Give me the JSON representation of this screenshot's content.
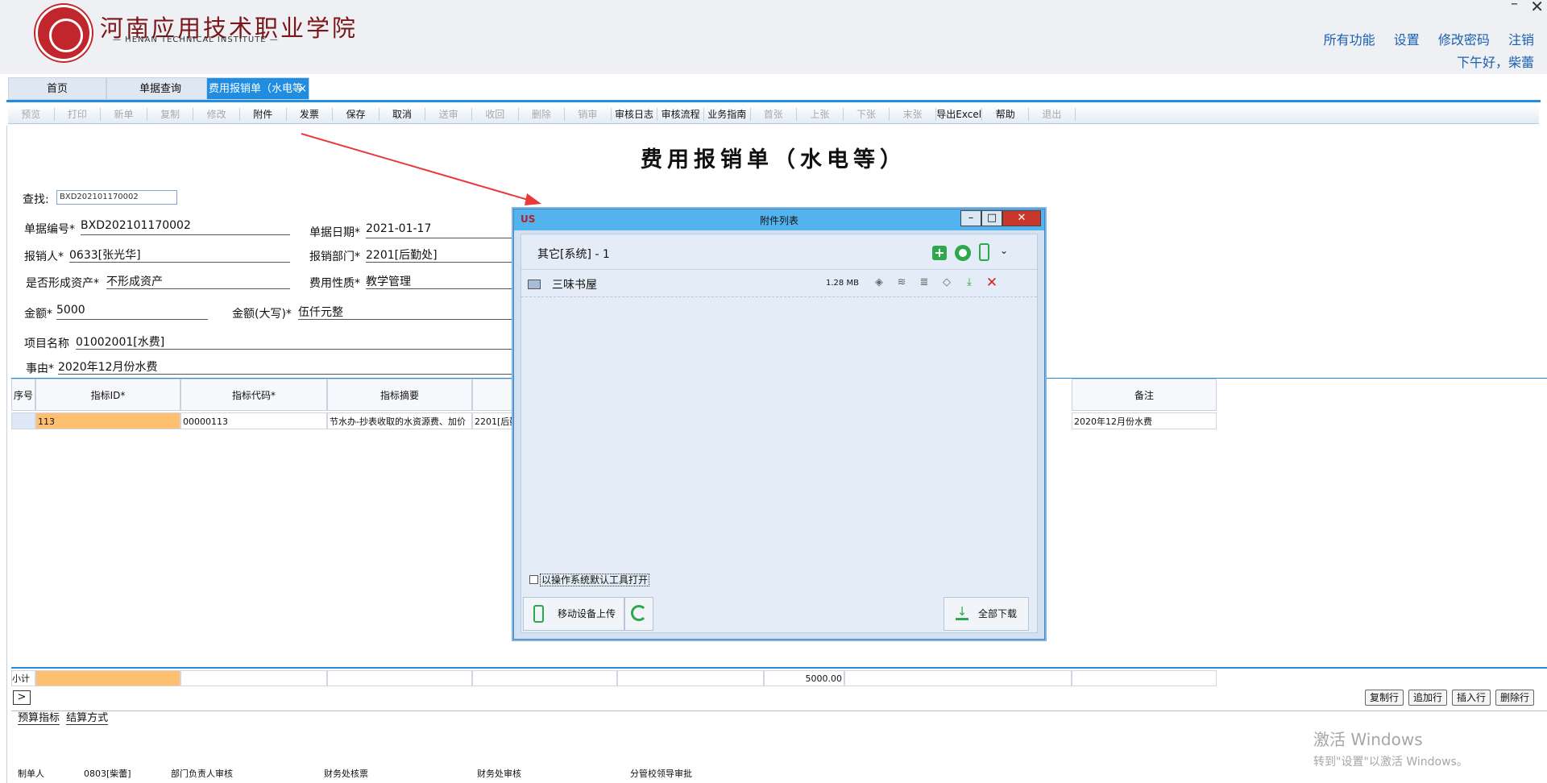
{
  "header": {
    "institute_cn": "河南应用技术职业学院",
    "institute_en": "— HENAN TECHNICAL INSTITUTE —",
    "nav": [
      "所有功能",
      "设置",
      "修改密码",
      "注销"
    ],
    "greeting": "下午好，柴蕾"
  },
  "tabs": [
    "首页",
    "单据查询",
    "费用报销单（水电等"
  ],
  "toolbar": [
    {
      "label": "预览",
      "enabled": false
    },
    {
      "label": "打印",
      "enabled": false
    },
    {
      "label": "新单",
      "enabled": false
    },
    {
      "label": "复制",
      "enabled": false
    },
    {
      "label": "修改",
      "enabled": false
    },
    {
      "label": "附件",
      "enabled": true
    },
    {
      "label": "发票",
      "enabled": true
    },
    {
      "label": "保存",
      "enabled": true
    },
    {
      "label": "取消",
      "enabled": true
    },
    {
      "label": "送审",
      "enabled": false
    },
    {
      "label": "收回",
      "enabled": false
    },
    {
      "label": "删除",
      "enabled": false
    },
    {
      "label": "销审",
      "enabled": false
    },
    {
      "label": "审核日志",
      "enabled": true
    },
    {
      "label": "审核流程",
      "enabled": true
    },
    {
      "label": "业务指南",
      "enabled": true
    },
    {
      "label": "首张",
      "enabled": false
    },
    {
      "label": "上张",
      "enabled": false
    },
    {
      "label": "下张",
      "enabled": false
    },
    {
      "label": "末张",
      "enabled": false
    },
    {
      "label": "导出Excel",
      "enabled": true
    },
    {
      "label": "帮助",
      "enabled": true
    },
    {
      "label": "退出",
      "enabled": false
    }
  ],
  "form": {
    "title": "费用报销单（水电等）",
    "search_label": "查找:",
    "search_value": "BXD202101170002",
    "doc_no_label": "单据编号*",
    "doc_no": "BXD202101170002",
    "date_label": "单据日期*",
    "date": "2021-01-17",
    "claimant_label": "报销人*",
    "claimant": "0633[张光华]",
    "dept_label": "报销部门*",
    "dept": "2201[后勤处]",
    "asset_label": "是否形成资产*",
    "asset": "不形成资产",
    "nature_label": "费用性质*",
    "nature": "教学管理",
    "amount_label": "金额*",
    "amount": "5000",
    "amount_cn_label": "金额(大写)*",
    "amount_cn": "伍仟元整",
    "project_label": "项目名称",
    "project": "01002001[水费]",
    "reason_label": "事由*",
    "reason": "2020年12月份水费"
  },
  "grid": {
    "headers": [
      "序号",
      "指标ID*",
      "指标代码*",
      "指标摘要",
      "备注"
    ],
    "row": {
      "id": "113",
      "code": "00000113",
      "summary": "节水办-抄表收取的水资源费、加价",
      "dept": "2201[后勤",
      "remark": "2020年12月份水费"
    },
    "subtotal_label": "小计",
    "subtotal_value": "5000.00",
    "row_buttons": [
      "复制行",
      "追加行",
      "插入行",
      "删除行"
    ],
    "bottom_tabs": [
      "预算指标",
      "结算方式"
    ]
  },
  "signatures": [
    "制单人",
    "0803[柴蕾]",
    "部门负责人审核",
    "财务处核票",
    "财务处审核",
    "分管校领导审批"
  ],
  "activation": {
    "line1": "激活 Windows",
    "line2": "转到\"设置\"以激活 Windows。"
  },
  "dialog": {
    "logo": "US",
    "title": "附件列表",
    "group": "其它[系统] - 1",
    "file_name": "三味书屋",
    "file_size": "1.28 MB",
    "checkbox_label": "以操作系统默认工具打开",
    "upload_label": "移动设备上传",
    "download_all_label": "全部下载"
  },
  "colors": {
    "accent": "#1f8de2",
    "highlight_cell": "#ffbf70",
    "dialog_title": "#53b3ef",
    "close_red": "#c9372c"
  }
}
